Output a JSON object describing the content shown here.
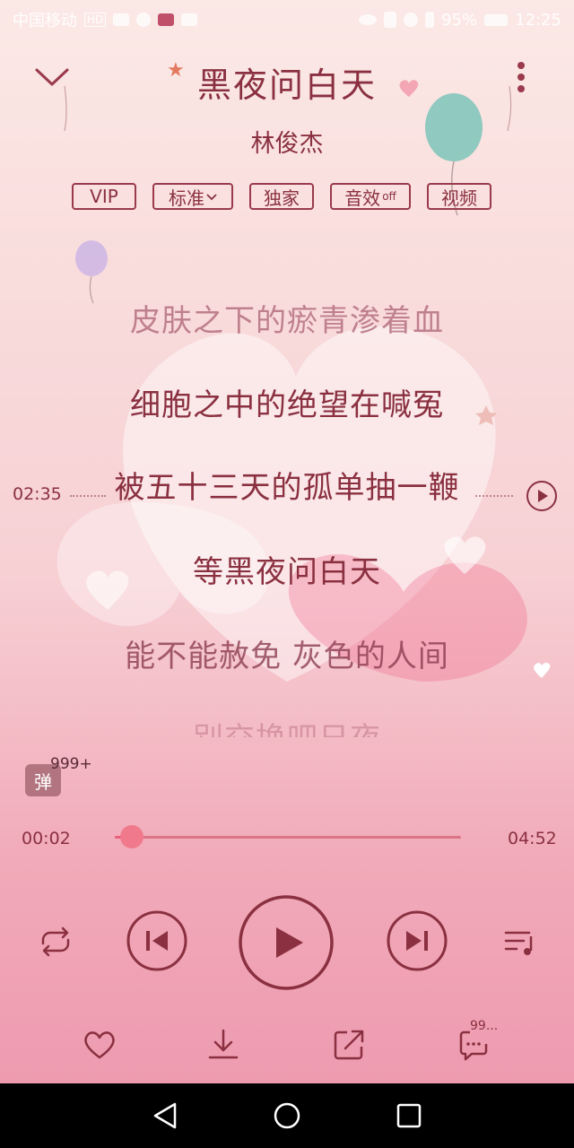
{
  "status_bar": {
    "carrier": "中国移动",
    "network": "HD",
    "battery": "95%",
    "time": "12:25"
  },
  "header": {
    "collapse_icon": "chevron-down-icon",
    "more_icon": "more-vertical-icon"
  },
  "song": {
    "title": "黑夜问白天",
    "artist": "林俊杰"
  },
  "tags": {
    "vip": "VIP",
    "quality": "标准",
    "exclusive": "独家",
    "sound_effect": "音效",
    "sound_effect_state": "off",
    "video": "视频"
  },
  "lyrics": [
    "皮肤之下的瘀青渗着血",
    "细胞之中的绝望在喊冤",
    "被五十三天的孤单抽一鞭",
    "等黑夜问白天",
    "能不能赦免 灰色的人间",
    "别交换吧日夜"
  ],
  "lyric_seek_time": "02:35",
  "danmu": {
    "label": "弹",
    "count": "999+"
  },
  "playback": {
    "current_time": "00:02",
    "total_time": "04:52",
    "progress_fraction": 0.05
  },
  "comments_badge": "99...",
  "colors": {
    "accent": "#8a3040",
    "progress": "#e8607a",
    "star": "#e37a60"
  }
}
